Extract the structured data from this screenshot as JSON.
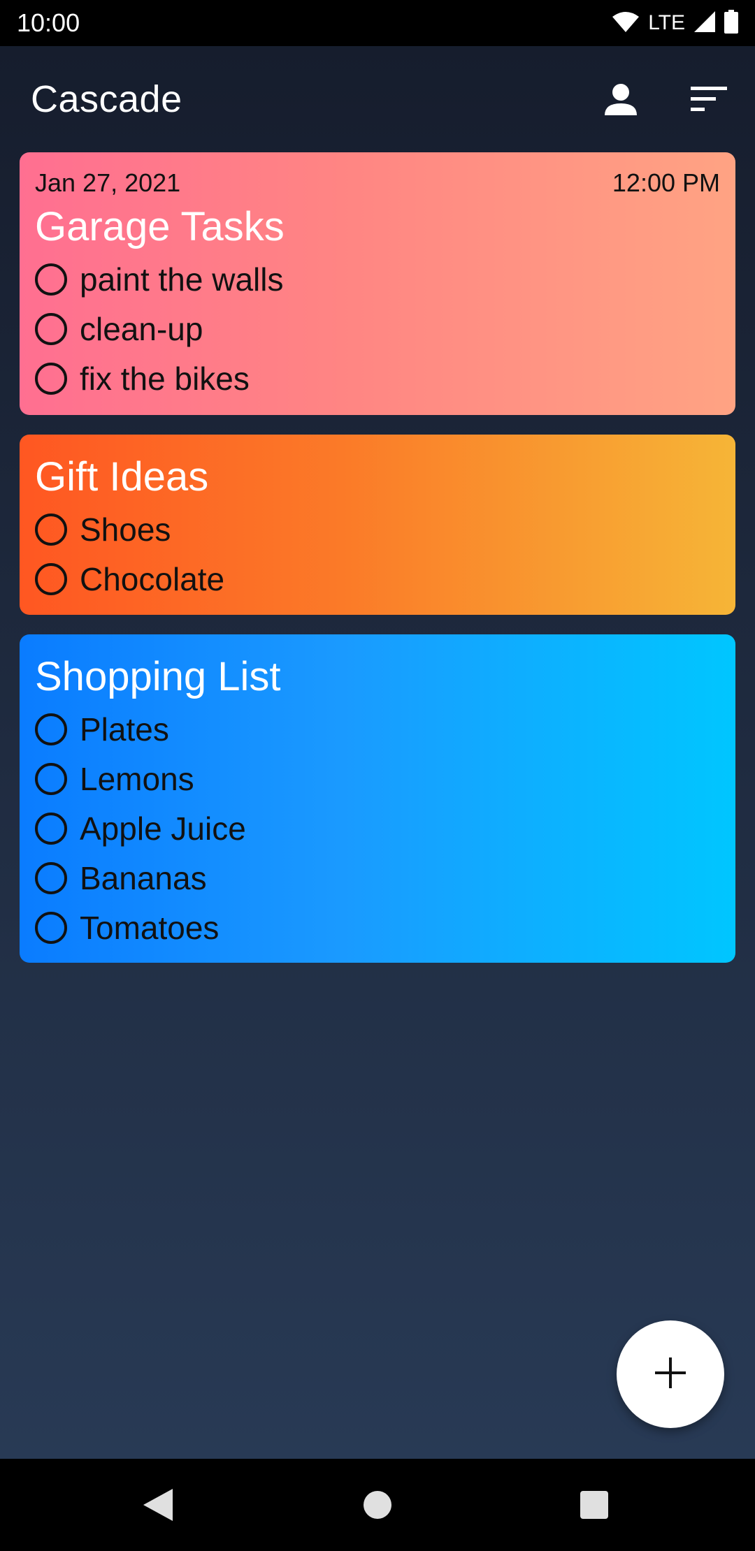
{
  "status_bar": {
    "time": "10:00",
    "network": "LTE",
    "icons": [
      "wifi-icon",
      "signal-icon",
      "battery-icon"
    ]
  },
  "app_bar": {
    "title": "Cascade",
    "icons": [
      "account-icon",
      "sort-icon"
    ]
  },
  "cards": [
    {
      "date": "Jan 27, 2021",
      "time": "12:00 PM",
      "title": "Garage Tasks",
      "items": [
        "paint the walls",
        "clean-up",
        "fix the bikes"
      ],
      "gradient": [
        "#ff6f91",
        "#ffa383"
      ]
    },
    {
      "title": "Gift Ideas",
      "items": [
        "Shoes",
        "Chocolate"
      ],
      "gradient": [
        "#ff5722",
        "#f6b537"
      ]
    },
    {
      "title": "Shopping List",
      "items": [
        "Plates",
        "Lemons",
        "Apple Juice",
        "Bananas",
        "Tomatoes"
      ],
      "gradient": [
        "#0a7cff",
        "#00c6ff"
      ]
    }
  ],
  "fab": {
    "icon": "plus-icon"
  },
  "nav_bar": {
    "icons": [
      "back-icon",
      "home-icon",
      "recents-icon"
    ]
  },
  "colors": {
    "background_top": "#161d2d",
    "background_bottom": "#283a55",
    "fab": "#ffffff"
  }
}
